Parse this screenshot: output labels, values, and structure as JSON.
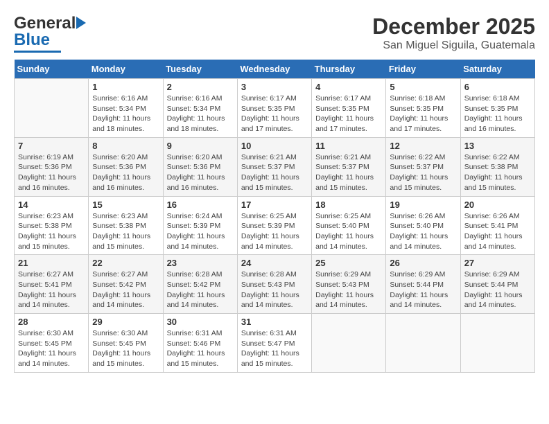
{
  "logo": {
    "general": "General",
    "blue": "Blue"
  },
  "title": "December 2025",
  "location": "San Miguel Siguila, Guatemala",
  "days_header": [
    "Sunday",
    "Monday",
    "Tuesday",
    "Wednesday",
    "Thursday",
    "Friday",
    "Saturday"
  ],
  "weeks": [
    [
      {
        "day": "",
        "info": ""
      },
      {
        "day": "1",
        "info": "Sunrise: 6:16 AM\nSunset: 5:34 PM\nDaylight: 11 hours\nand 18 minutes."
      },
      {
        "day": "2",
        "info": "Sunrise: 6:16 AM\nSunset: 5:34 PM\nDaylight: 11 hours\nand 18 minutes."
      },
      {
        "day": "3",
        "info": "Sunrise: 6:17 AM\nSunset: 5:35 PM\nDaylight: 11 hours\nand 17 minutes."
      },
      {
        "day": "4",
        "info": "Sunrise: 6:17 AM\nSunset: 5:35 PM\nDaylight: 11 hours\nand 17 minutes."
      },
      {
        "day": "5",
        "info": "Sunrise: 6:18 AM\nSunset: 5:35 PM\nDaylight: 11 hours\nand 17 minutes."
      },
      {
        "day": "6",
        "info": "Sunrise: 6:18 AM\nSunset: 5:35 PM\nDaylight: 11 hours\nand 16 minutes."
      }
    ],
    [
      {
        "day": "7",
        "info": "Sunrise: 6:19 AM\nSunset: 5:36 PM\nDaylight: 11 hours\nand 16 minutes."
      },
      {
        "day": "8",
        "info": "Sunrise: 6:20 AM\nSunset: 5:36 PM\nDaylight: 11 hours\nand 16 minutes."
      },
      {
        "day": "9",
        "info": "Sunrise: 6:20 AM\nSunset: 5:36 PM\nDaylight: 11 hours\nand 16 minutes."
      },
      {
        "day": "10",
        "info": "Sunrise: 6:21 AM\nSunset: 5:37 PM\nDaylight: 11 hours\nand 15 minutes."
      },
      {
        "day": "11",
        "info": "Sunrise: 6:21 AM\nSunset: 5:37 PM\nDaylight: 11 hours\nand 15 minutes."
      },
      {
        "day": "12",
        "info": "Sunrise: 6:22 AM\nSunset: 5:37 PM\nDaylight: 11 hours\nand 15 minutes."
      },
      {
        "day": "13",
        "info": "Sunrise: 6:22 AM\nSunset: 5:38 PM\nDaylight: 11 hours\nand 15 minutes."
      }
    ],
    [
      {
        "day": "14",
        "info": "Sunrise: 6:23 AM\nSunset: 5:38 PM\nDaylight: 11 hours\nand 15 minutes."
      },
      {
        "day": "15",
        "info": "Sunrise: 6:23 AM\nSunset: 5:38 PM\nDaylight: 11 hours\nand 15 minutes."
      },
      {
        "day": "16",
        "info": "Sunrise: 6:24 AM\nSunset: 5:39 PM\nDaylight: 11 hours\nand 14 minutes."
      },
      {
        "day": "17",
        "info": "Sunrise: 6:25 AM\nSunset: 5:39 PM\nDaylight: 11 hours\nand 14 minutes."
      },
      {
        "day": "18",
        "info": "Sunrise: 6:25 AM\nSunset: 5:40 PM\nDaylight: 11 hours\nand 14 minutes."
      },
      {
        "day": "19",
        "info": "Sunrise: 6:26 AM\nSunset: 5:40 PM\nDaylight: 11 hours\nand 14 minutes."
      },
      {
        "day": "20",
        "info": "Sunrise: 6:26 AM\nSunset: 5:41 PM\nDaylight: 11 hours\nand 14 minutes."
      }
    ],
    [
      {
        "day": "21",
        "info": "Sunrise: 6:27 AM\nSunset: 5:41 PM\nDaylight: 11 hours\nand 14 minutes."
      },
      {
        "day": "22",
        "info": "Sunrise: 6:27 AM\nSunset: 5:42 PM\nDaylight: 11 hours\nand 14 minutes."
      },
      {
        "day": "23",
        "info": "Sunrise: 6:28 AM\nSunset: 5:42 PM\nDaylight: 11 hours\nand 14 minutes."
      },
      {
        "day": "24",
        "info": "Sunrise: 6:28 AM\nSunset: 5:43 PM\nDaylight: 11 hours\nand 14 minutes."
      },
      {
        "day": "25",
        "info": "Sunrise: 6:29 AM\nSunset: 5:43 PM\nDaylight: 11 hours\nand 14 minutes."
      },
      {
        "day": "26",
        "info": "Sunrise: 6:29 AM\nSunset: 5:44 PM\nDaylight: 11 hours\nand 14 minutes."
      },
      {
        "day": "27",
        "info": "Sunrise: 6:29 AM\nSunset: 5:44 PM\nDaylight: 11 hours\nand 14 minutes."
      }
    ],
    [
      {
        "day": "28",
        "info": "Sunrise: 6:30 AM\nSunset: 5:45 PM\nDaylight: 11 hours\nand 14 minutes."
      },
      {
        "day": "29",
        "info": "Sunrise: 6:30 AM\nSunset: 5:45 PM\nDaylight: 11 hours\nand 15 minutes."
      },
      {
        "day": "30",
        "info": "Sunrise: 6:31 AM\nSunset: 5:46 PM\nDaylight: 11 hours\nand 15 minutes."
      },
      {
        "day": "31",
        "info": "Sunrise: 6:31 AM\nSunset: 5:47 PM\nDaylight: 11 hours\nand 15 minutes."
      },
      {
        "day": "",
        "info": ""
      },
      {
        "day": "",
        "info": ""
      },
      {
        "day": "",
        "info": ""
      }
    ]
  ]
}
